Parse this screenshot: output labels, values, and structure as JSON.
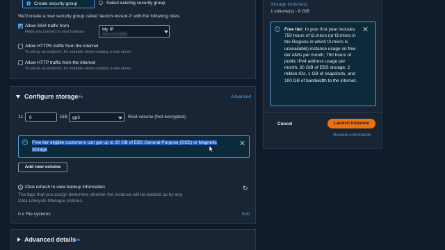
{
  "network": {
    "create_sg_label": "Create security group",
    "select_sg_label": "Select existing security group",
    "description": "We'll create a new security group called 'launch-wizard-3' with the following rules:",
    "ssh": {
      "label": "Allow SSH traffic from",
      "help": "Helps you connect to your instance",
      "checked": true
    },
    "ssh_source": {
      "value": "My IP",
      "ip": "203.0.113.25/32"
    },
    "https": {
      "label": "Allow HTTPS traffic from the internet",
      "help": "To set up an endpoint, for example when creating a web server",
      "checked": false
    },
    "http": {
      "label": "Allow HTTP traffic from the internet",
      "help": "To set up an endpoint, for example when creating a web server",
      "checked": false
    }
  },
  "storage": {
    "title": "Configure storage",
    "info": "Info",
    "advanced": "Advanced",
    "count": "1x",
    "size": "8",
    "unit": "GiB",
    "volume_type": "gp3",
    "root_label": "Root volume  (Not encrypted)",
    "free_tier_alert": "Free tier eligible customers can get up to 30 GB of EBS General Purpose (SSD) or Magnetic storage",
    "add_volume": "Add new volume",
    "backup_title": "Click refresh to view backup information",
    "backup_desc": "The tags that you assign determine whether the instance will be backed up by any Data Lifecycle Manager policies.",
    "file_systems": "0 x File systems",
    "edit": "Edit"
  },
  "advanced_details": {
    "title": "Advanced details",
    "info": "Info"
  },
  "summary": {
    "storage_link": "Storage (volumes)",
    "storage_value": "1 volume(s) - 8 GiB",
    "free_tier_title": "Free tier:",
    "free_tier_text": "In your first year includes 750 hours of t2.micro (or t3.micro in the Regions in which t2.micro is unavailable) instance usage on free tier AMIs per month, 750 hours of public IPv4 address usage per month, 30 GiB of EBS storage, 2 million IOs, 1 GB of snapshots, and 100 GB of bandwidth to the internet.",
    "cancel": "Cancel",
    "launch": "Launch instance",
    "review": "Review commands"
  },
  "colors": {
    "accent": "#539fe5",
    "launch": "#ec7211",
    "bg": "#0f1b2a",
    "panel": "#192534"
  }
}
